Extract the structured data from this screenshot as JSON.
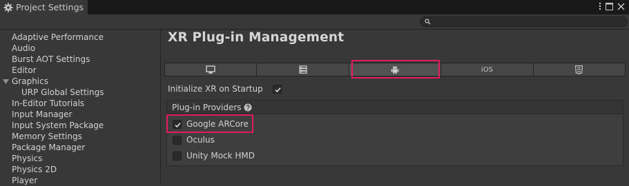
{
  "window": {
    "title": "Project Settings",
    "icons": [
      "gear-icon",
      "kebab-menu-icon",
      "maximize-icon",
      "close-icon"
    ]
  },
  "search": {
    "placeholder": ""
  },
  "sidebar": {
    "items": [
      {
        "label": "Adaptive Performance",
        "level": 0
      },
      {
        "label": "Audio",
        "level": 0
      },
      {
        "label": "Burst AOT Settings",
        "level": 0
      },
      {
        "label": "Editor",
        "level": 0
      },
      {
        "label": "Graphics",
        "level": 0,
        "expanded": true
      },
      {
        "label": "URP Global Settings",
        "level": 1
      },
      {
        "label": "In-Editor Tutorials",
        "level": 0
      },
      {
        "label": "Input Manager",
        "level": 0
      },
      {
        "label": "Input System Package",
        "level": 0
      },
      {
        "label": "Memory Settings",
        "level": 0
      },
      {
        "label": "Package Manager",
        "level": 0
      },
      {
        "label": "Physics",
        "level": 0
      },
      {
        "label": "Physics 2D",
        "level": 0
      },
      {
        "label": "Player",
        "level": 0
      }
    ]
  },
  "main": {
    "title": "XR Plug-in Management",
    "platform_tabs": [
      {
        "icon": "desktop-icon",
        "label": ""
      },
      {
        "icon": "server-icon",
        "label": ""
      },
      {
        "icon": "android-icon",
        "label": "",
        "selected": true
      },
      {
        "icon": "",
        "label": "iOS"
      },
      {
        "icon": "html5-icon",
        "label": ""
      }
    ],
    "init_on_startup": {
      "label": "Initialize XR on Startup",
      "checked": true
    },
    "providers": {
      "header": "Plug-in Providers",
      "items": [
        {
          "label": "Google ARCore",
          "checked": true
        },
        {
          "label": "Oculus",
          "checked": false
        },
        {
          "label": "Unity Mock HMD",
          "checked": false
        }
      ]
    }
  },
  "colors": {
    "highlight": "#e51c5d",
    "background": "#383838",
    "titlebar": "#191919"
  }
}
